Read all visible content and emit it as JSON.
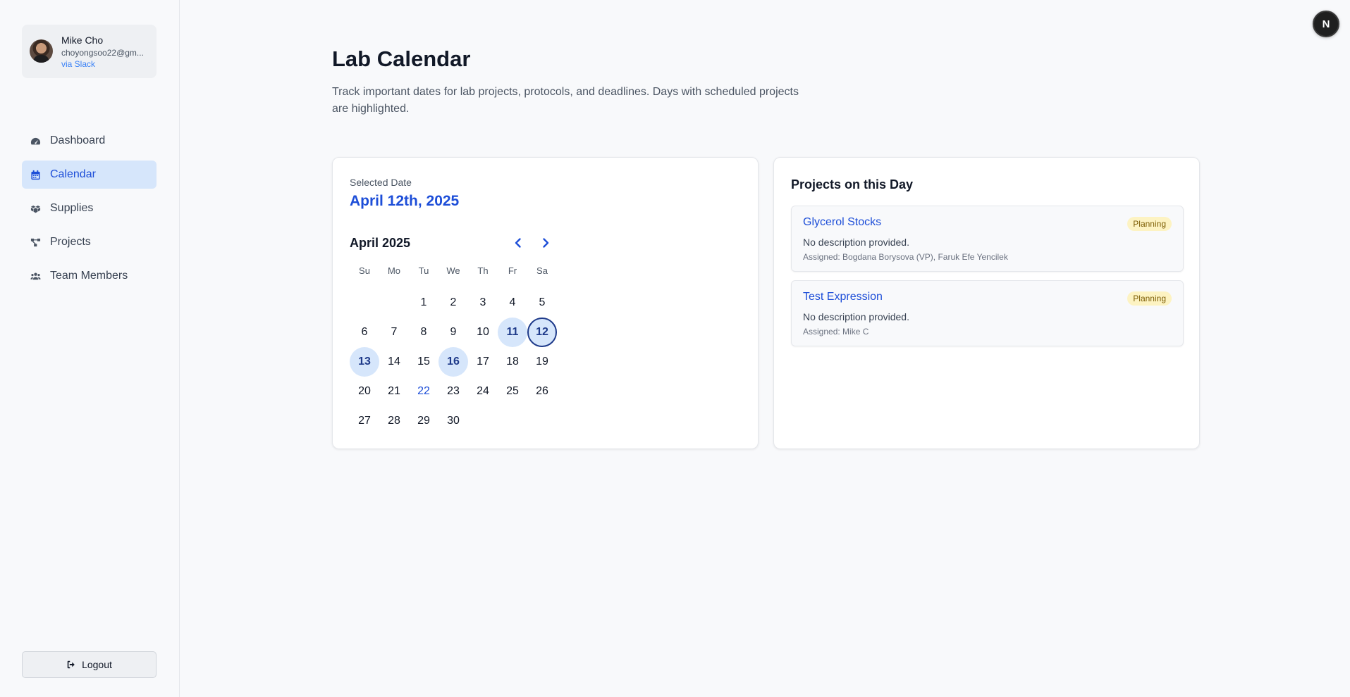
{
  "user": {
    "name": "Mike Cho",
    "email": "choyongsoo22@gm...",
    "via": "via Slack"
  },
  "nav": {
    "items": [
      {
        "label": "Dashboard",
        "icon": "gauge-icon"
      },
      {
        "label": "Calendar",
        "icon": "calendar-icon",
        "active": true
      },
      {
        "label": "Supplies",
        "icon": "boxes-icon"
      },
      {
        "label": "Projects",
        "icon": "project-diagram-icon"
      },
      {
        "label": "Team Members",
        "icon": "users-icon"
      }
    ]
  },
  "logout_label": "Logout",
  "page": {
    "title": "Lab Calendar",
    "description": "Track important dates for lab projects, protocols, and deadlines. Days with scheduled projects are highlighted."
  },
  "calendar": {
    "selected_label": "Selected Date",
    "selected_date": "April 12th, 2025",
    "month_label": "April 2025",
    "weekdays": [
      "Su",
      "Mo",
      "Tu",
      "We",
      "Th",
      "Fr",
      "Sa"
    ],
    "weeks": [
      [
        "",
        "",
        "1",
        "2",
        "3",
        "4",
        "5"
      ],
      [
        "6",
        "7",
        "8",
        "9",
        "10",
        "11",
        "12"
      ],
      [
        "13",
        "14",
        "15",
        "16",
        "17",
        "18",
        "19"
      ],
      [
        "20",
        "21",
        "22",
        "23",
        "24",
        "25",
        "26"
      ],
      [
        "27",
        "28",
        "29",
        "30",
        "",
        "",
        ""
      ]
    ],
    "project_days": [
      "11",
      "12",
      "13",
      "16"
    ],
    "selected_day": "12",
    "today": "22"
  },
  "projects_panel": {
    "title": "Projects on this Day",
    "projects": [
      {
        "name": "Glycerol Stocks",
        "status": "Planning",
        "description": "No description provided.",
        "assigned": "Assigned: Bogdana Borysova (VP), Faruk Efe Yencilek"
      },
      {
        "name": "Test Expression",
        "status": "Planning",
        "description": "No description provided.",
        "assigned": "Assigned: Mike C"
      }
    ]
  },
  "corner_badge": "N",
  "colors": {
    "accent": "#1d4ed8",
    "active_nav_bg": "#d6e6fb",
    "status_badge_bg": "#fdf3c2"
  }
}
